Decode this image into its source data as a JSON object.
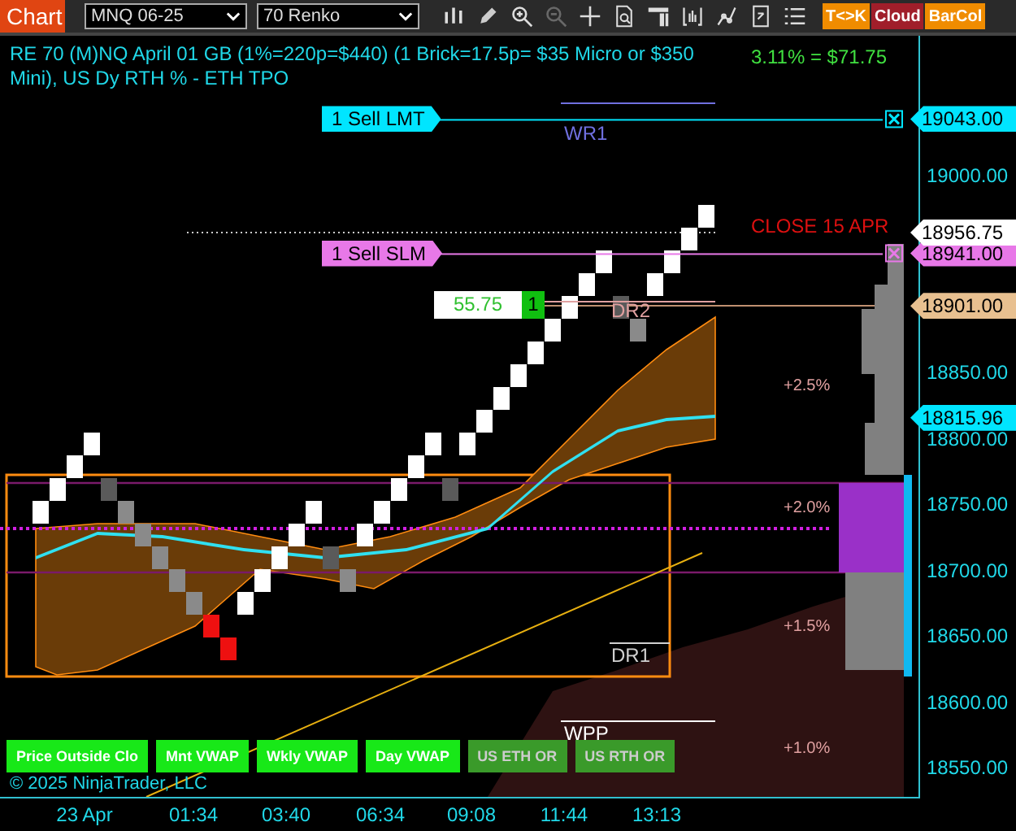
{
  "toolbar": {
    "title": "Chart",
    "instrument": "MNQ 06-25",
    "period": "70 Renko",
    "tools": [
      {
        "kind": "candles",
        "disabled": false
      },
      {
        "kind": "pencil",
        "disabled": false
      },
      {
        "kind": "zoom-in",
        "disabled": false
      },
      {
        "kind": "zoom-out",
        "disabled": true
      },
      {
        "kind": "cross",
        "disabled": false
      },
      {
        "kind": "doc-search",
        "disabled": false
      },
      {
        "kind": "columns",
        "disabled": false
      },
      {
        "kind": "bars",
        "disabled": false
      },
      {
        "kind": "nodes",
        "disabled": false
      },
      {
        "kind": "doc",
        "disabled": false
      },
      {
        "kind": "list",
        "disabled": false
      }
    ],
    "buttons": [
      {
        "label": "T<>K",
        "color": "#f08c00"
      },
      {
        "label": "Cloud",
        "color": "#a01e2a"
      },
      {
        "label": "BarCol",
        "color": "#f08c00"
      }
    ]
  },
  "chart": {
    "header": "RE 70 (M)NQ April 01 GB (1%=220p=$440) (1 Brick=17.5p= $35 Micro or $350 Mini), US Dy RTH % - ETH TPO",
    "pnl": "3.11% = $71.75",
    "orders": [
      {
        "label": "1 Sell LMT",
        "price": "19043.00",
        "color": "#00e5ff"
      },
      {
        "label": "1 Sell SLM",
        "price": "18941.00",
        "color": "#e878e8"
      }
    ],
    "price_tags": [
      {
        "price": "18956.75",
        "color": "#ffffff"
      },
      {
        "price": "18901.00",
        "color": "#e8c090"
      },
      {
        "price": "18815.96",
        "color": "#00e5ff"
      }
    ],
    "levels": [
      {
        "label": "WR1"
      },
      {
        "label": "DR2"
      },
      {
        "label": "DR1"
      },
      {
        "label": "WPP"
      },
      {
        "label": "CLOSE 15 APR"
      }
    ],
    "percent_labels": [
      "+2.5%",
      "+2.0%",
      "+1.5%",
      "+1.0%"
    ],
    "position": {
      "pnl": "55.75",
      "quantity": "1"
    },
    "indicators": [
      {
        "label": "Price Outside Clo",
        "on": true
      },
      {
        "label": "Mnt VWAP",
        "on": true
      },
      {
        "label": "Wkly VWAP",
        "on": true
      },
      {
        "label": "Day VWAP",
        "on": true
      },
      {
        "label": "US ETH OR",
        "on": false
      },
      {
        "label": "US RTH OR",
        "on": false
      }
    ],
    "copyright": "© 2025 NinjaTrader, LLC",
    "y_ticks": [
      "19000.00",
      "18850.00",
      "18800.00",
      "18750.00",
      "18700.00",
      "18650.00",
      "18600.00",
      "18550.00"
    ],
    "x_ticks": [
      "23 Apr",
      "01:34",
      "03:40",
      "06:34",
      "09:08",
      "11:44",
      "13:13"
    ]
  }
}
